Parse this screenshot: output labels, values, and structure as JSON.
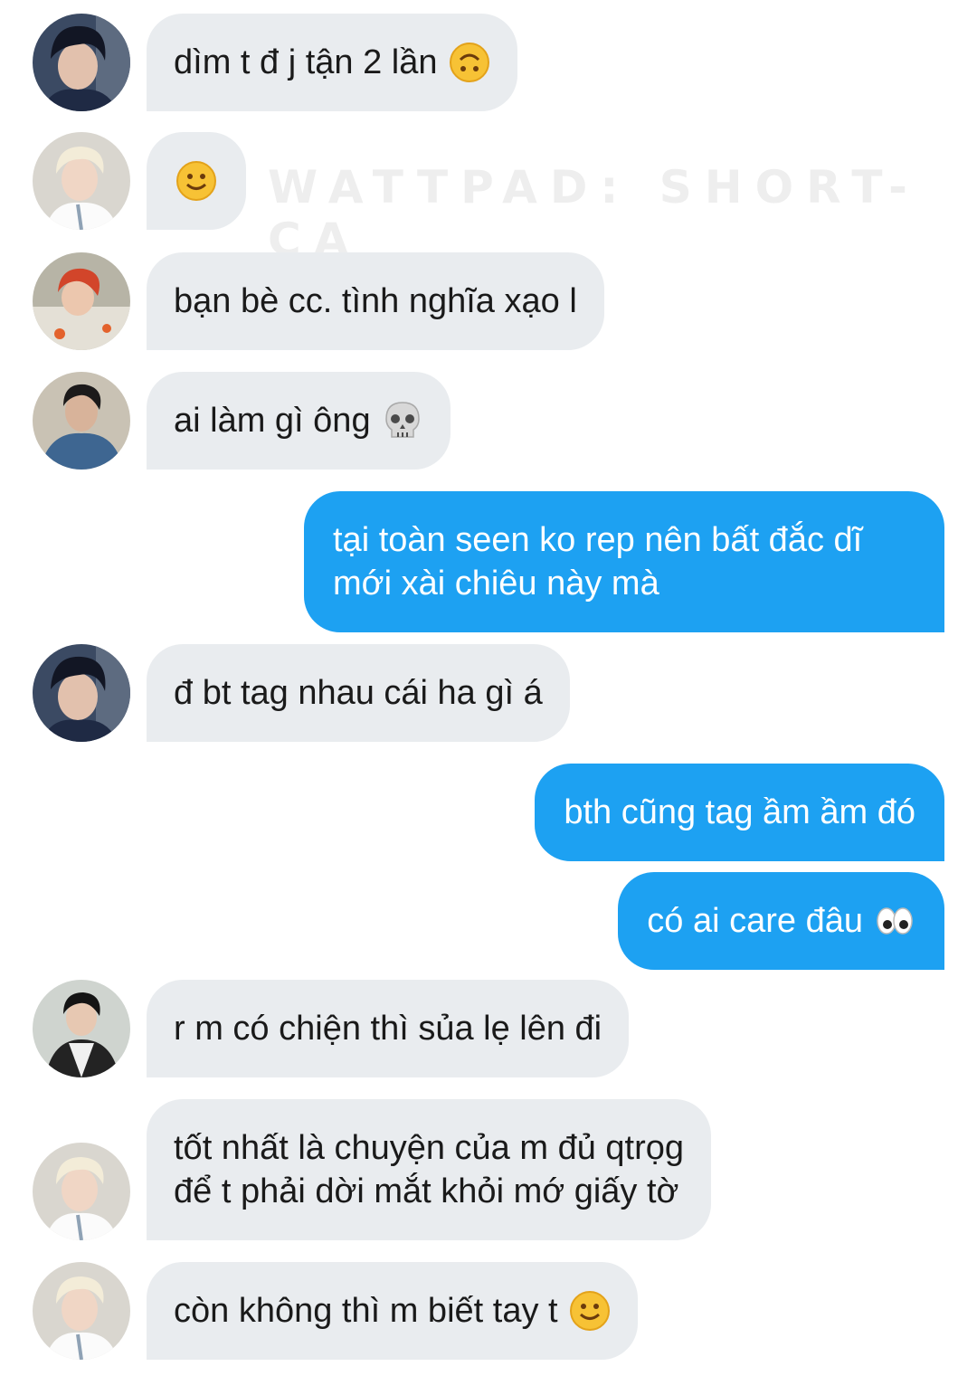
{
  "watermark": "WATTPAD: SHORT-CA",
  "colors": {
    "incoming_bubble": "#e9ecef",
    "outgoing_bubble": "#1da1f2"
  },
  "messages": [
    {
      "direction": "in",
      "avatar": "avatar-dark-hair-boy",
      "text": "dìm t đ j tận 2 lần",
      "emoji": "upside-down-face-icon"
    },
    {
      "direction": "in",
      "avatar": "avatar-blond-boy",
      "text": "",
      "emoji": "slightly-smiling-face-icon"
    },
    {
      "direction": "in",
      "avatar": "avatar-red-hair-boy",
      "text": "bạn bè cc. tình nghĩa xạo l"
    },
    {
      "direction": "in",
      "avatar": "avatar-denim-boy",
      "text": "ai làm gì ông",
      "emoji": "skull-icon"
    },
    {
      "direction": "out",
      "lines": [
        "tại toàn seen ko rep nên bất đắc dĩ",
        "mới xài chiêu này mà"
      ]
    },
    {
      "direction": "in",
      "avatar": "avatar-dark-hair-boy",
      "text": "đ bt tag nhau cái ha gì á"
    },
    {
      "direction": "out",
      "text": "bth cũng tag ầm ầm đó"
    },
    {
      "direction": "out",
      "text": "có ai care đâu",
      "emoji": "eyes-icon"
    },
    {
      "direction": "in",
      "avatar": "avatar-black-hair-boy",
      "text": "r m có chiện thì sủa lẹ lên đi"
    },
    {
      "direction": "in",
      "avatar": "avatar-blond-boy",
      "lines": [
        "tốt nhất là chuyện của m đủ qtrọg",
        "để t phải dời mắt khỏi mớ giấy tờ"
      ]
    },
    {
      "direction": "in",
      "avatar": "avatar-blond-boy",
      "text": "còn không thì m biết tay t",
      "emoji": "slightly-smiling-face-icon"
    }
  ]
}
